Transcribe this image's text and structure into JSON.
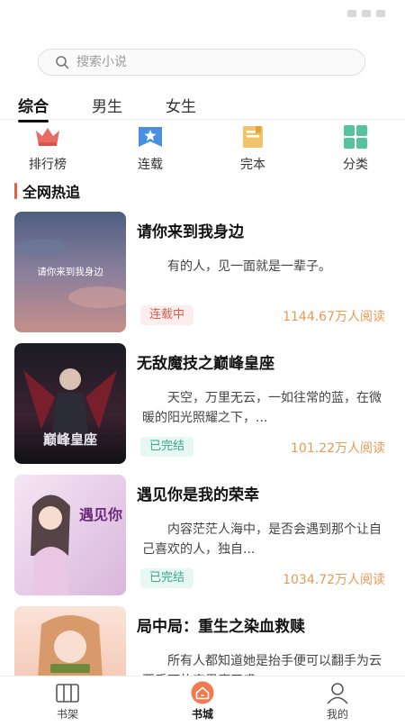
{
  "search": {
    "placeholder": "搜索小说"
  },
  "tabs": [
    {
      "label": "综合",
      "active": true
    },
    {
      "label": "男生",
      "active": false
    },
    {
      "label": "女生",
      "active": false
    }
  ],
  "categories": [
    {
      "label": "排行榜",
      "icon": "crown-icon"
    },
    {
      "label": "连载",
      "icon": "bookmark-star-icon"
    },
    {
      "label": "完本",
      "icon": "finished-book-icon"
    },
    {
      "label": "分类",
      "icon": "grid-icon"
    }
  ],
  "section": {
    "title": "全网热追"
  },
  "books": [
    {
      "title": "请你来到我身边",
      "description": "有的人，见一面就是一辈子。",
      "status": "连载中",
      "reads": "1144.67万人阅读",
      "cover_text": "请你来到我身边"
    },
    {
      "title": "无敌魔技之巅峰皇座",
      "description": "天空，万里无云，一如往常的蓝，在微暖的阳光照耀之下，...",
      "status": "已完结",
      "reads": "101.22万人阅读",
      "cover_text": "巅峰皇座"
    },
    {
      "title": "遇见你是我的荣幸",
      "description": "内容茫茫人海中，是否会遇到那个让自己喜欢的人，独自...",
      "status": "已完结",
      "reads": "1034.72万人阅读",
      "cover_text": "遇见你"
    },
    {
      "title": "局中局：重生之染血救赎",
      "description": "所有人都知道她是抬手便可以翻手为云覆手雨的商界魔王盛...",
      "status": "",
      "reads": "",
      "cover_text": ""
    }
  ],
  "bottom_nav": [
    {
      "label": "书架",
      "icon": "bookshelf-icon",
      "active": false
    },
    {
      "label": "书城",
      "icon": "home-icon",
      "active": true
    },
    {
      "label": "我的",
      "icon": "user-icon",
      "active": false
    }
  ],
  "colors": {
    "accent": "#f07a4e",
    "serial": "#e05a50",
    "done": "#3aa48d",
    "reads": "#e69a54"
  }
}
